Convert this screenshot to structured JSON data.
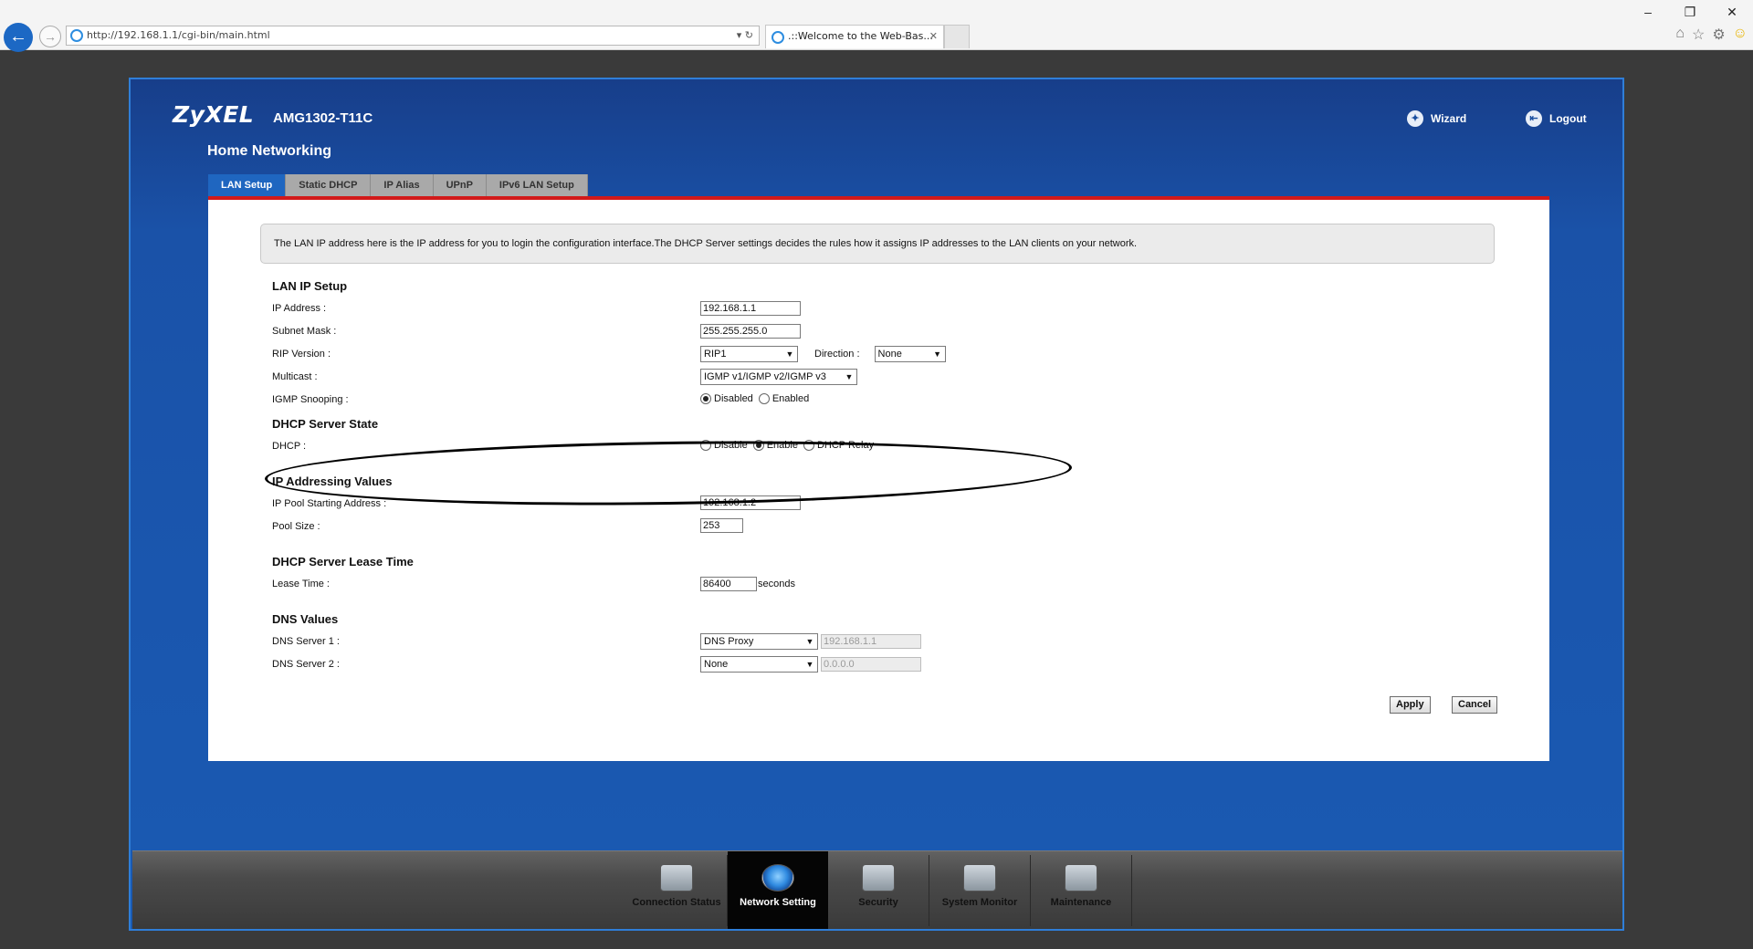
{
  "browser": {
    "url": "http://192.168.1.1/cgi-bin/main.html",
    "address_tools": "▾ ↻",
    "tab_title": ".::Welcome to the Web-Bas...",
    "window_controls": [
      "–",
      "❐",
      "✕"
    ],
    "toolbar_icons": [
      "home-icon",
      "star-icon",
      "gear-icon",
      "smiley-icon"
    ]
  },
  "header": {
    "brand": "ZyXEL",
    "model": "AMG1302-T11C",
    "page_title": "Home Networking",
    "wizard_label": "Wizard",
    "logout_label": "Logout"
  },
  "tabs": [
    {
      "label": "LAN Setup",
      "active": true
    },
    {
      "label": "Static DHCP",
      "active": false
    },
    {
      "label": "IP Alias",
      "active": false
    },
    {
      "label": "UPnP",
      "active": false
    },
    {
      "label": "IPv6 LAN Setup",
      "active": false
    }
  ],
  "info_text": "The LAN IP address here is the IP address for you to login the configuration interface.The DHCP Server settings decides the rules how it assigns IP addresses to the LAN clients on your network.",
  "lan_ip_setup": {
    "heading": "LAN IP Setup",
    "ip_address_label": "IP Address :",
    "ip_address_value": "192.168.1.1",
    "subnet_mask_label": "Subnet Mask :",
    "subnet_mask_value": "255.255.255.0",
    "rip_version_label": "RIP Version :",
    "rip_version_value": "RIP1",
    "direction_label": "Direction :",
    "direction_value": "None",
    "multicast_label": "Multicast :",
    "multicast_value": "IGMP v1/IGMP v2/IGMP v3",
    "igmp_snooping_label": "IGMP Snooping :",
    "igmp_disabled": "Disabled",
    "igmp_enabled": "Enabled",
    "igmp_selected": "Disabled"
  },
  "dhcp_state": {
    "heading": "DHCP Server State",
    "dhcp_label": "DHCP :",
    "opt_disable": "Disable",
    "opt_enable": "Enable",
    "opt_relay": "DHCP Relay",
    "selected": "Enable"
  },
  "ip_addressing": {
    "heading": "IP Addressing Values",
    "pool_start_label": "IP Pool Starting Address :",
    "pool_start_value": "192.168.1.2",
    "pool_size_label": "Pool Size :",
    "pool_size_value": "253"
  },
  "lease": {
    "heading": "DHCP Server Lease Time",
    "lease_label": "Lease Time :",
    "lease_value": "86400",
    "lease_unit": "seconds"
  },
  "dns": {
    "heading": "DNS Values",
    "dns1_label": "DNS Server 1 :",
    "dns1_mode": "DNS Proxy",
    "dns1_ip": "192.168.1.1",
    "dns2_label": "DNS Server 2 :",
    "dns2_mode": "None",
    "dns2_ip": "0.0.0.0"
  },
  "buttons": {
    "apply": "Apply",
    "cancel": "Cancel"
  },
  "bottom_nav": [
    {
      "label": "Connection Status",
      "icon": "monitor-icon",
      "active": false
    },
    {
      "label": "Network Setting",
      "icon": "globe-gear-icon",
      "active": true
    },
    {
      "label": "Security",
      "icon": "shield-icon",
      "active": false
    },
    {
      "label": "System Monitor",
      "icon": "chart-icon",
      "active": false
    },
    {
      "label": "Maintenance",
      "icon": "tools-icon",
      "active": false
    }
  ],
  "colors": {
    "router_blue": "#1850a4",
    "active_tab": "#1f66c0",
    "red_rule": "#d21a1a",
    "bottom_bar": "#4a4a4a"
  }
}
